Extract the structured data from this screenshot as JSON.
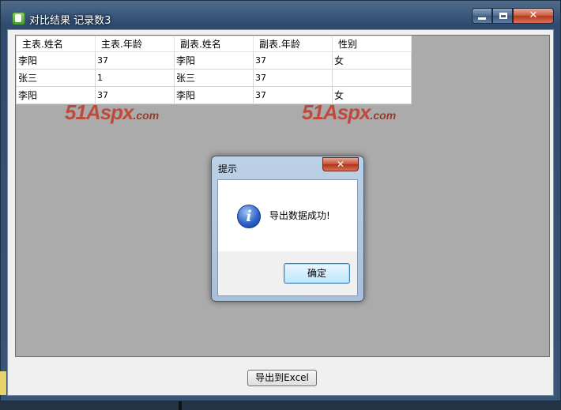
{
  "window": {
    "title": "对比结果 记录数3",
    "controls": {
      "minimize": "",
      "maximize": "",
      "close": "✕"
    }
  },
  "table": {
    "headers": [
      "主表.姓名",
      "主表.年龄",
      "副表.姓名",
      "副表.年龄",
      "性别"
    ],
    "rows": [
      [
        "李阳",
        "37",
        "李阳",
        "37",
        "女"
      ],
      [
        "张三",
        "1",
        "张三",
        "37",
        ""
      ],
      [
        "李阳",
        "37",
        "李阳",
        "37",
        "女"
      ]
    ]
  },
  "watermark": {
    "text": "51Aspx",
    "suffix": ".com"
  },
  "export_button": "导出到Excel",
  "dialog": {
    "title": "提示",
    "close": "✕",
    "icon": "info-icon",
    "message": "导出数据成功!",
    "ok": "确定"
  }
}
